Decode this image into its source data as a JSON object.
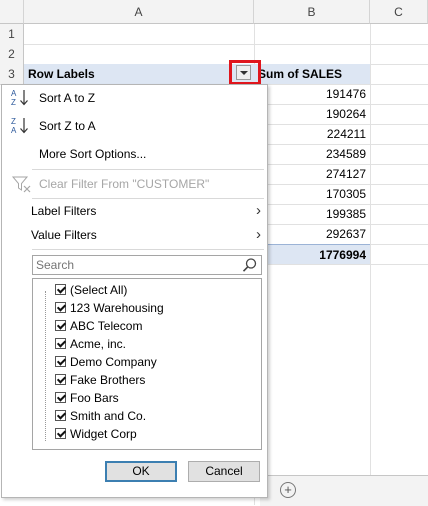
{
  "columns": [
    "A",
    "B",
    "C"
  ],
  "rows": [
    "1",
    "2",
    "3"
  ],
  "pivot": {
    "row_labels_header": "Row Labels",
    "sum_header": "Sum of SALES",
    "values": [
      "191476",
      "190264",
      "224211",
      "234589",
      "274127",
      "170305",
      "199385",
      "292637"
    ],
    "grand_total": "1776994"
  },
  "menu": {
    "sort_az": "Sort A to Z",
    "sort_za": "Sort Z to A",
    "more_sort": "More Sort Options...",
    "clear_filter": "Clear Filter From \"CUSTOMER\"",
    "label_filters": "Label Filters",
    "value_filters": "Value Filters"
  },
  "search": {
    "placeholder": "Search"
  },
  "list_items": [
    "(Select All)",
    "123 Warehousing",
    "ABC Telecom",
    "Acme, inc.",
    "Demo Company",
    "Fake Brothers",
    "Foo Bars",
    "Smith and Co.",
    "Widget Corp"
  ],
  "buttons": {
    "ok": "OK",
    "cancel": "Cancel"
  },
  "icons": {
    "sort_az_icon": "sort-ascending-icon",
    "sort_za_icon": "sort-descending-icon",
    "clear_filter_icon": "clear-filter-icon",
    "search_icon": "magnifier-icon",
    "add_sheet_icon": "plus-circle-icon"
  },
  "colors": {
    "highlight_box": "#e0161d",
    "pivot_header_bg": "#dde6f3",
    "ok_border": "#3c7fb1"
  }
}
